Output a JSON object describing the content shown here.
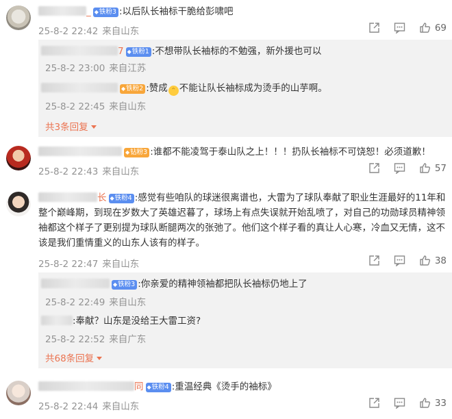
{
  "comments": [
    {
      "name_tail": "_",
      "badge": "铁粉3",
      "text": ":以后队长袖标干脆给彭啸吧",
      "time": "25-8-2 22:42",
      "location": "来自山东",
      "likes": "69",
      "replies": [
        {
          "name_tail": "7",
          "badge": "铁粉1",
          "text": ":不想带队长袖标的不勉强，新外援也可以",
          "time": "25-8-2 23:00",
          "location": "来自江苏"
        },
        {
          "badge": "铁粉2",
          "text_a": ":赞成",
          "text_b": "不能让队长袖标成为烫手的山芋啊。",
          "time": "25-8-2 22:45",
          "location": "来自山东"
        }
      ],
      "more": "共3条回复"
    },
    {
      "badge": "钻粉3",
      "text": ":谁都不能凌驾于泰山队之上！！！扔队长袖标不可饶恕！必须道歉！",
      "time": "25-8-2 22:43",
      "location": "来自山东",
      "likes": "57"
    },
    {
      "name_tail": "长",
      "badge": "铁粉4",
      "text_l1": ":感觉有些咱队的球迷很离谱也，大雷为了球队奉献了职业生涯最好的11年和",
      "text_l2": "整个巅峰期，到现在岁数大了英雄迟暮了，球场上有点失误就开始乱喷了，对自己的功勋球员精神领",
      "text_l3": "袖都这个样子了更别提为球队断腿两次的张弛了。他们这个样子看的真让人心寒，冷血又无情，这不",
      "text_l4": "该是我们重情重义的山东人该有的样子。",
      "time": "25-8-2 22:47",
      "location": "来自山东",
      "likes": "38",
      "replies": [
        {
          "badge": "铁粉3",
          "text": ":你亲爱的精神领袖都把队长袖标仍地上了",
          "time": "25-8-2 22:49",
          "location": "来自山东"
        },
        {
          "text": ":奉献？山东是没给王大雷工资?",
          "time": "25-8-2 22:52",
          "location": "来自广东"
        }
      ],
      "more": "共68条回复"
    },
    {
      "name_tail": "同",
      "badge": "铁粉4",
      "text": ":重温经典《烫手的袖标》",
      "time": "25-8-2 22:44",
      "location": "来自山东",
      "likes": "33"
    }
  ],
  "icons": {
    "share": "share-icon",
    "comment": "comment-icon",
    "like": "thumbs-up-icon",
    "emoji": "grimace-emoji-icon",
    "gem": "gem-icon"
  },
  "colors": {
    "accent": "#eb7350",
    "badge_blue": "#5b8ef0",
    "badge_orange": "#f8a63a",
    "meta": "#939393",
    "reply_bg": "#f2f2f2"
  }
}
